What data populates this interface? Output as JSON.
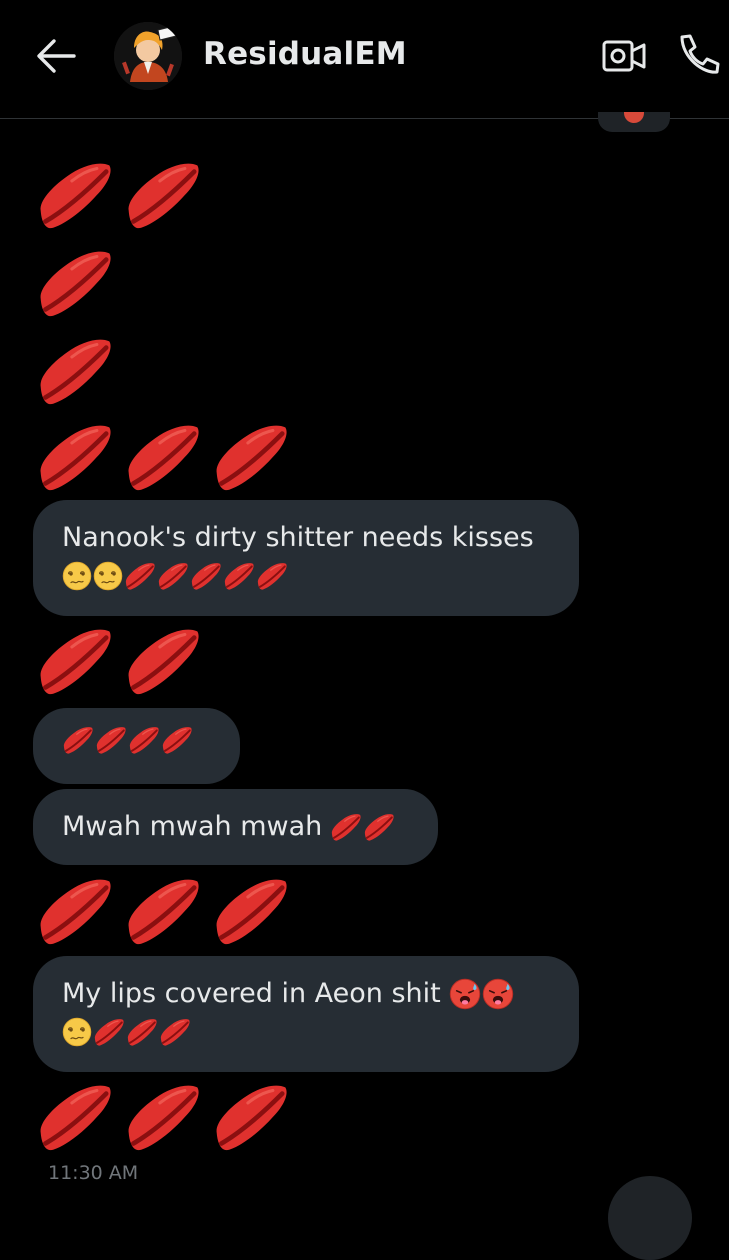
{
  "header": {
    "contact_name": "ResidualEM",
    "back_icon": "arrow-left-icon",
    "video_icon": "video-camera-icon",
    "call_icon": "phone-icon"
  },
  "messages": [
    {
      "type": "emoji",
      "emoji": "kiss-mark",
      "count": 2
    },
    {
      "type": "emoji",
      "emoji": "kiss-mark",
      "count": 1
    },
    {
      "type": "emoji",
      "emoji": "kiss-mark",
      "count": 1
    },
    {
      "type": "emoji",
      "emoji": "kiss-mark",
      "count": 3
    },
    {
      "type": "text",
      "text": "Nanook's dirty shitter needs kisses",
      "trailing_emoji": [
        "woozy-face",
        "woozy-face",
        "kiss-mark",
        "kiss-mark",
        "kiss-mark",
        "kiss-mark",
        "kiss-mark"
      ]
    },
    {
      "type": "emoji",
      "emoji": "kiss-mark",
      "count": 2
    },
    {
      "type": "text",
      "text": "",
      "trailing_emoji": [
        "kiss-mark",
        "kiss-mark",
        "kiss-mark",
        "kiss-mark"
      ]
    },
    {
      "type": "text",
      "text": "Mwah mwah mwah",
      "trailing_emoji": [
        "kiss-mark",
        "kiss-mark"
      ]
    },
    {
      "type": "emoji",
      "emoji": "kiss-mark",
      "count": 3
    },
    {
      "type": "text",
      "text": "My lips covered in Aeon shit",
      "trailing_emoji": [
        "hot-face",
        "hot-face",
        "woozy-face",
        "kiss-mark",
        "kiss-mark",
        "kiss-mark"
      ]
    },
    {
      "type": "emoji",
      "emoji": "kiss-mark",
      "count": 3
    }
  ],
  "msg1_text": "Nanook's dirty shitter needs kisses",
  "msg2_text": "Mwah mwah mwah",
  "msg3_text": "My lips covered in Aeon shit",
  "timestamp": "11:30 AM",
  "colors": {
    "background": "#000000",
    "bubble": "#262d34",
    "text": "#e7e9ea",
    "secondary_text": "#71767b",
    "kiss_red": "#e0312e"
  }
}
